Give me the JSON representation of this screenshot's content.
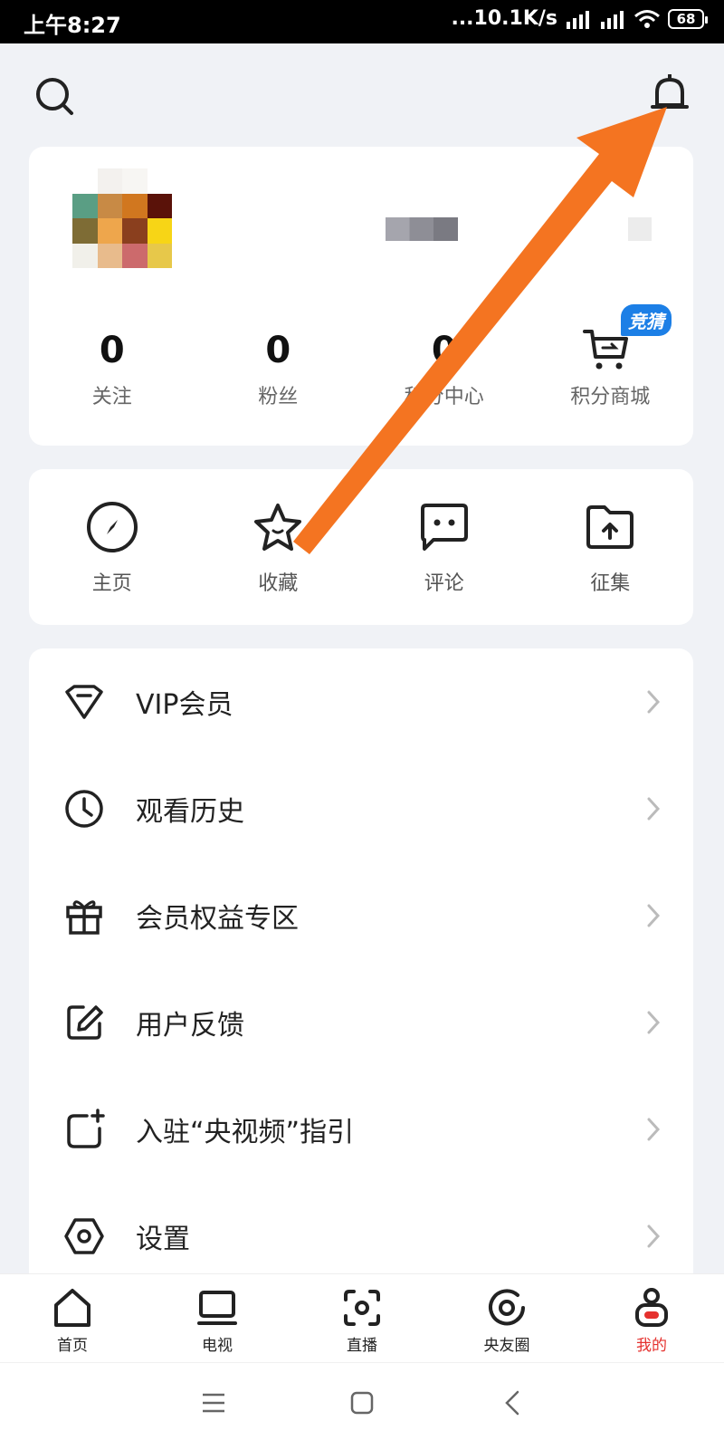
{
  "status_bar": {
    "time": "上午8:27",
    "net_speed": "...10.1K/s",
    "battery": "68"
  },
  "profile": {
    "stats": [
      {
        "value": "0",
        "label": "关注"
      },
      {
        "value": "0",
        "label": "粉丝"
      },
      {
        "value": "0",
        "label": "积分中心"
      }
    ],
    "shop_label": "积分商城",
    "shop_badge": "竞猜"
  },
  "shortcuts": [
    {
      "label": "主页",
      "icon": "compass-icon"
    },
    {
      "label": "收藏",
      "icon": "star-icon"
    },
    {
      "label": "评论",
      "icon": "comment-icon"
    },
    {
      "label": "征集",
      "icon": "folder-upload-icon"
    }
  ],
  "menu": [
    {
      "label": "VIP会员",
      "icon": "diamond-icon"
    },
    {
      "label": "观看历史",
      "icon": "clock-icon"
    },
    {
      "label": "会员权益专区",
      "icon": "gift-icon"
    },
    {
      "label": "用户反馈",
      "icon": "edit-icon"
    },
    {
      "label": "入驻“央视频”指引",
      "icon": "add-square-icon"
    },
    {
      "label": "设置",
      "icon": "settings-icon"
    }
  ],
  "bottom_nav": [
    {
      "label": "首页",
      "icon": "home-icon"
    },
    {
      "label": "电视",
      "icon": "tv-icon"
    },
    {
      "label": "直播",
      "icon": "live-icon"
    },
    {
      "label": "央友圈",
      "icon": "circle-icon"
    },
    {
      "label": "我的",
      "icon": "profile-icon",
      "active": true
    }
  ],
  "colors": {
    "accent": "#e5312e",
    "annotation_arrow": "#f47421",
    "badge": "#1c7fe6"
  }
}
